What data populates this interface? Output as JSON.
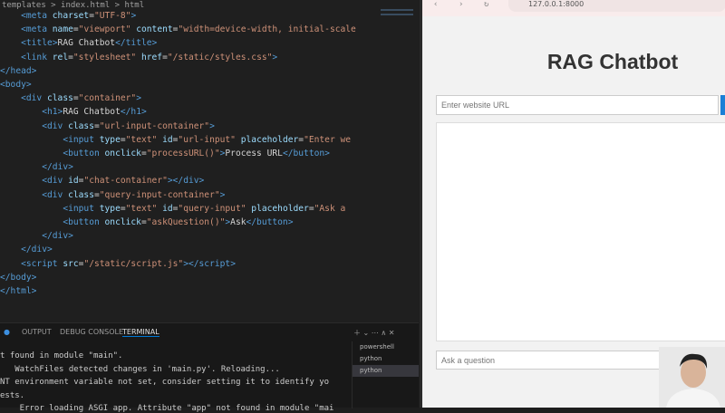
{
  "editor": {
    "breadcrumb": "templates > index.html > html",
    "lines": [
      "    <meta charset=\"UTF-8\">",
      "    <meta name=\"viewport\" content=\"width=device-width, initial-scale",
      "    <title>RAG Chatbot</title>",
      "    <link rel=\"stylesheet\" href=\"/static/styles.css\">",
      "</head>",
      "<body>",
      "    <div class=\"container\">",
      "        <h1>RAG Chatbot</h1>",
      "        <div class=\"url-input-container\">",
      "            <input type=\"text\" id=\"url-input\" placeholder=\"Enter we",
      "            <button onclick=\"processURL()\">Process URL</button>",
      "        </div>",
      "        <div id=\"chat-container\"></div>",
      "        <div class=\"query-input-container\">",
      "            <input type=\"text\" id=\"query-input\" placeholder=\"Ask a",
      "            <button onclick=\"askQuestion()\">Ask</button>",
      "        </div>",
      "    </div>",
      "    <script src=\"/static/script.js\"></script>",
      "</body>",
      "</html>"
    ]
  },
  "panel": {
    "tabs": [
      "OUTPUT",
      "DEBUG CONSOLE",
      "TERMINAL"
    ],
    "terminal_lines": [
      "t found in module \"main\".",
      "   WatchFiles detected changes in 'main.py'. Reloading...",
      "NT environment variable not set, consider setting it to identify yo",
      "ests.",
      "    Error loading ASGI app. Attribute \"app\" not found in module \"mai"
    ],
    "terminals": [
      "powershell",
      "python",
      "python"
    ]
  },
  "browser": {
    "address": "127.0.0.1:8000",
    "title": "RAG Chatbot",
    "url_placeholder": "Enter website URL",
    "query_placeholder": "Ask a question",
    "accent": "#1a7fd6"
  }
}
